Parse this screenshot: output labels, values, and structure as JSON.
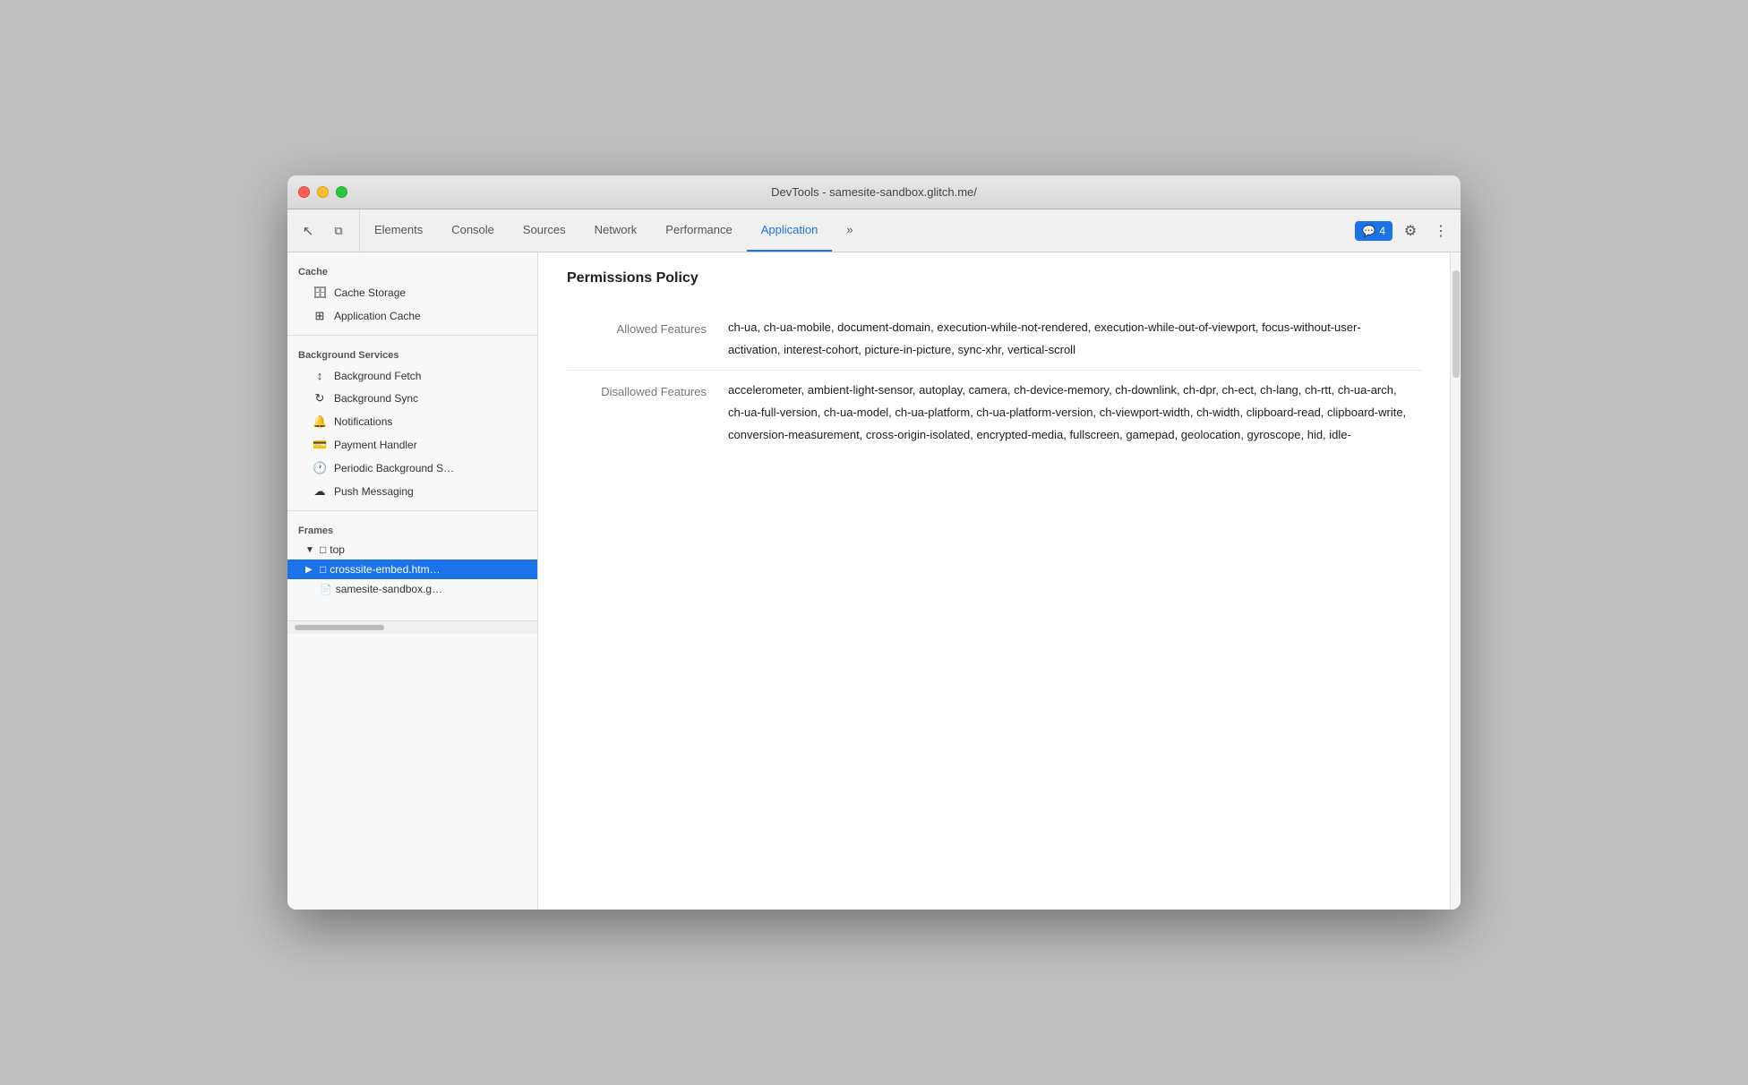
{
  "window": {
    "title": "DevTools - samesite-sandbox.glitch.me/"
  },
  "toolbar": {
    "icons": [
      {
        "name": "cursor-icon",
        "symbol": "↖",
        "label": "Cursor"
      },
      {
        "name": "device-icon",
        "symbol": "⧉",
        "label": "Device Toggle"
      }
    ],
    "tabs": [
      {
        "id": "elements",
        "label": "Elements",
        "active": false
      },
      {
        "id": "console",
        "label": "Console",
        "active": false
      },
      {
        "id": "sources",
        "label": "Sources",
        "active": false
      },
      {
        "id": "network",
        "label": "Network",
        "active": false
      },
      {
        "id": "performance",
        "label": "Performance",
        "active": false
      },
      {
        "id": "application",
        "label": "Application",
        "active": true
      }
    ],
    "more_tabs_label": "»",
    "badge_count": "4",
    "settings_icon": "⚙",
    "more_icon": "⋮"
  },
  "sidebar": {
    "cache_section": {
      "header": "Cache",
      "items": [
        {
          "id": "cache-storage",
          "label": "Cache Storage",
          "icon": "🗄"
        },
        {
          "id": "application-cache",
          "label": "Application Cache",
          "icon": "⊞"
        }
      ]
    },
    "background_services_section": {
      "header": "Background Services",
      "items": [
        {
          "id": "background-fetch",
          "label": "Background Fetch",
          "icon": "↕"
        },
        {
          "id": "background-sync",
          "label": "Background Sync",
          "icon": "↻"
        },
        {
          "id": "notifications",
          "label": "Notifications",
          "icon": "🔔"
        },
        {
          "id": "payment-handler",
          "label": "Payment Handler",
          "icon": "💳"
        },
        {
          "id": "periodic-background-sync",
          "label": "Periodic Background S…",
          "icon": "🕐"
        },
        {
          "id": "push-messaging",
          "label": "Push Messaging",
          "icon": "☁"
        }
      ]
    },
    "frames_section": {
      "header": "Frames",
      "items": [
        {
          "id": "top",
          "label": "top",
          "icon": "▶",
          "expanded": true,
          "children": [
            {
              "id": "crosssite-embed",
              "label": "crosssite-embed.htm…",
              "icon": "▶",
              "selected": true
            },
            {
              "id": "samesite-sandbox",
              "label": "samesite-sandbox.g…",
              "icon": "📄"
            }
          ]
        }
      ]
    }
  },
  "content": {
    "title": "Permissions Policy",
    "allowed_features_label": "Allowed Features",
    "allowed_features_value": "ch-ua, ch-ua-mobile, document-domain, execution-while-not-rendered, execution-while-out-of-viewport, focus-without-user-activation, interest-cohort, picture-in-picture, sync-xhr, vertical-scroll",
    "disallowed_features_label": "Disallowed Features",
    "disallowed_features_value": "accelerometer, ambient-light-sensor, autoplay, camera, ch-device-memory, ch-downlink, ch-dpr, ch-ect, ch-lang, ch-rtt, ch-ua-arch, ch-ua-full-version, ch-ua-model, ch-ua-platform, ch-ua-platform-version, ch-viewport-width, ch-width, clipboard-read, clipboard-write, conversion-measurement, cross-origin-isolated, encrypted-media, fullscreen, gamepad, geolocation, gyroscope, hid, idle-"
  }
}
